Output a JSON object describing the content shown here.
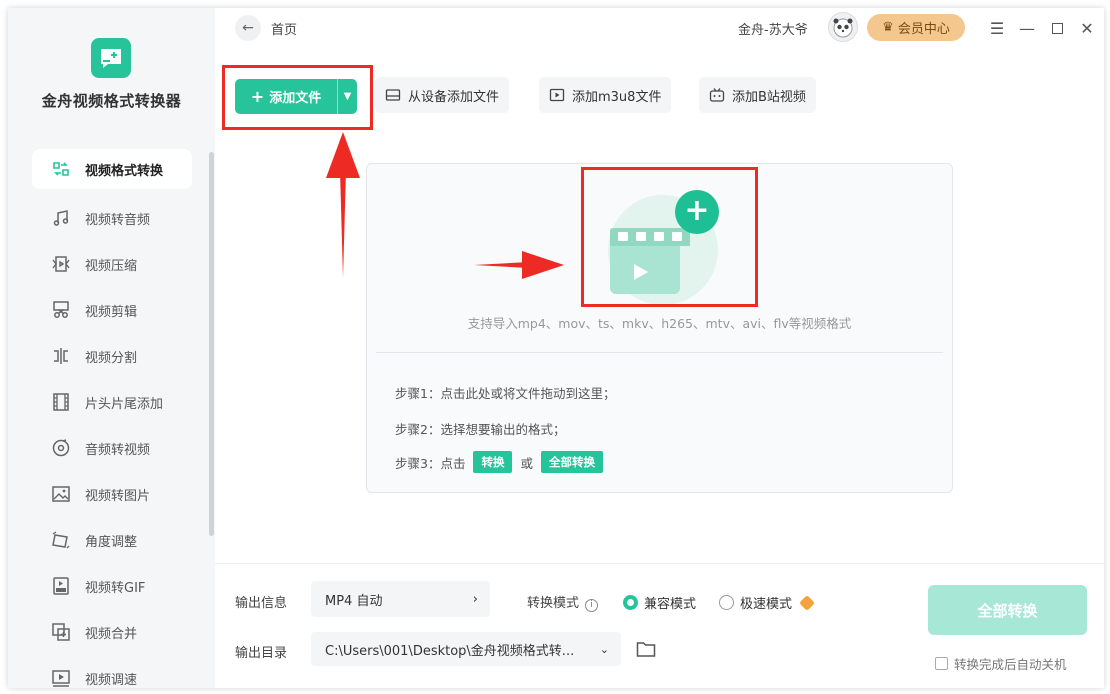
{
  "app": {
    "name": "金舟视频格式转换器"
  },
  "sidebar": {
    "items": [
      {
        "label": "视频格式转换",
        "icon": "convert-icon",
        "active": true
      },
      {
        "label": "视频转音频",
        "icon": "music-icon"
      },
      {
        "label": "视频压缩",
        "icon": "compress-icon"
      },
      {
        "label": "视频剪辑",
        "icon": "scissors-icon"
      },
      {
        "label": "视频分割",
        "icon": "split-icon"
      },
      {
        "label": "片头片尾添加",
        "icon": "film-icon"
      },
      {
        "label": "音频转视频",
        "icon": "disc-icon"
      },
      {
        "label": "视频转图片",
        "icon": "image-icon"
      },
      {
        "label": "角度调整",
        "icon": "rotate-icon"
      },
      {
        "label": "视频转GIF",
        "icon": "gif-icon"
      },
      {
        "label": "视频合并",
        "icon": "merge-icon"
      },
      {
        "label": "视频调速",
        "icon": "speed-icon"
      }
    ]
  },
  "header": {
    "breadcrumb": "首页",
    "user_name": "金舟-苏大爷",
    "vip_label": "会员中心"
  },
  "toolbar": {
    "add_file": "添加文件",
    "add_from_device": "从设备添加文件",
    "add_m3u8": "添加m3u8文件",
    "add_bilibili": "添加B站视频"
  },
  "drop_area": {
    "support_text": "支持导入mp4、mov、ts、mkv、h265、mtv、avi、flv等视频格式",
    "step1": "步骤1：点击此处或将文件拖动到这里；",
    "step2": "步骤2：选择想要输出的格式；",
    "step3_prefix": "步骤3：点击",
    "step3_tag1": "转换",
    "step3_or": "或",
    "step3_tag2": "全部转换"
  },
  "bottom": {
    "output_info_label": "输出信息",
    "output_format": "MP4 自动",
    "mode_label": "转换模式",
    "mode_compat": "兼容模式",
    "mode_fast": "极速模式",
    "output_dir_label": "输出目录",
    "output_dir": "C:\\Users\\001\\Desktop\\金舟视频格式转...",
    "convert_all": "全部转换",
    "auto_shutdown": "转换完成后自动关机"
  },
  "colors": {
    "accent": "#27c49b",
    "annotation_red": "#ee2a24",
    "vip": "#f3c78e"
  }
}
